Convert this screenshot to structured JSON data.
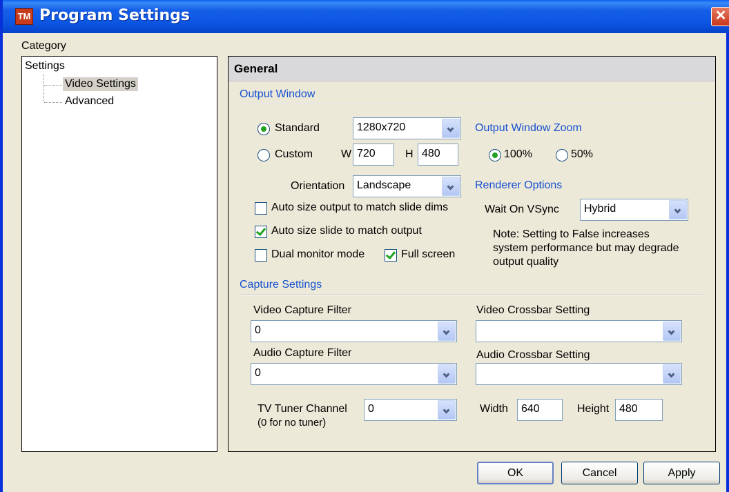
{
  "window": {
    "title": "Program Settings",
    "icon_text": "TM",
    "icon": "app-tm-icon",
    "close_icon": "close-icon"
  },
  "category": {
    "label": "Category",
    "tree": {
      "root": "Settings",
      "children": [
        "Video Settings",
        "Advanced"
      ],
      "selected": "Video Settings"
    }
  },
  "main": {
    "header": "General",
    "output_window": {
      "heading": "Output Window",
      "standard_label": "Standard",
      "standard_selected": true,
      "resolution": "1280x720",
      "custom_label": "Custom",
      "w_label": "W",
      "w_value": "720",
      "h_label": "H",
      "h_value": "480",
      "orientation_label": "Orientation",
      "orientation_value": "Landscape",
      "auto_size_output_label": "Auto size output to match slide dims",
      "auto_size_output_checked": false,
      "auto_size_slide_label": "Auto size slide to match output",
      "auto_size_slide_checked": true,
      "dual_monitor_label": "Dual monitor mode",
      "dual_monitor_checked": false,
      "full_screen_label": "Full screen",
      "full_screen_checked": true
    },
    "zoom": {
      "heading": "Output Window Zoom",
      "opt100": "100%",
      "opt50": "50%",
      "selected": "100%"
    },
    "renderer": {
      "heading": "Renderer Options",
      "vsync_label": "Wait On VSync",
      "vsync_value": "Hybrid",
      "note_line1": "Note: Setting to False increases",
      "note_line2": "system performance but may degrade",
      "note_line3": "output quality"
    },
    "capture": {
      "heading": "Capture Settings",
      "video_filter_label": "Video Capture Filter",
      "video_filter_value": "0",
      "video_crossbar_label": "Video Crossbar Setting",
      "video_crossbar_value": "",
      "audio_filter_label": "Audio Capture Filter",
      "audio_filter_value": "0",
      "audio_crossbar_label": "Audio Crossbar Setting",
      "audio_crossbar_value": "",
      "tuner_label": "TV Tuner Channel",
      "tuner_sub": "(0 for no tuner)",
      "tuner_value": "0",
      "width_label": "Width",
      "width_value": "640",
      "height_label": "Height",
      "height_value": "480"
    }
  },
  "buttons": {
    "ok": "OK",
    "cancel": "Cancel",
    "apply": "Apply"
  }
}
